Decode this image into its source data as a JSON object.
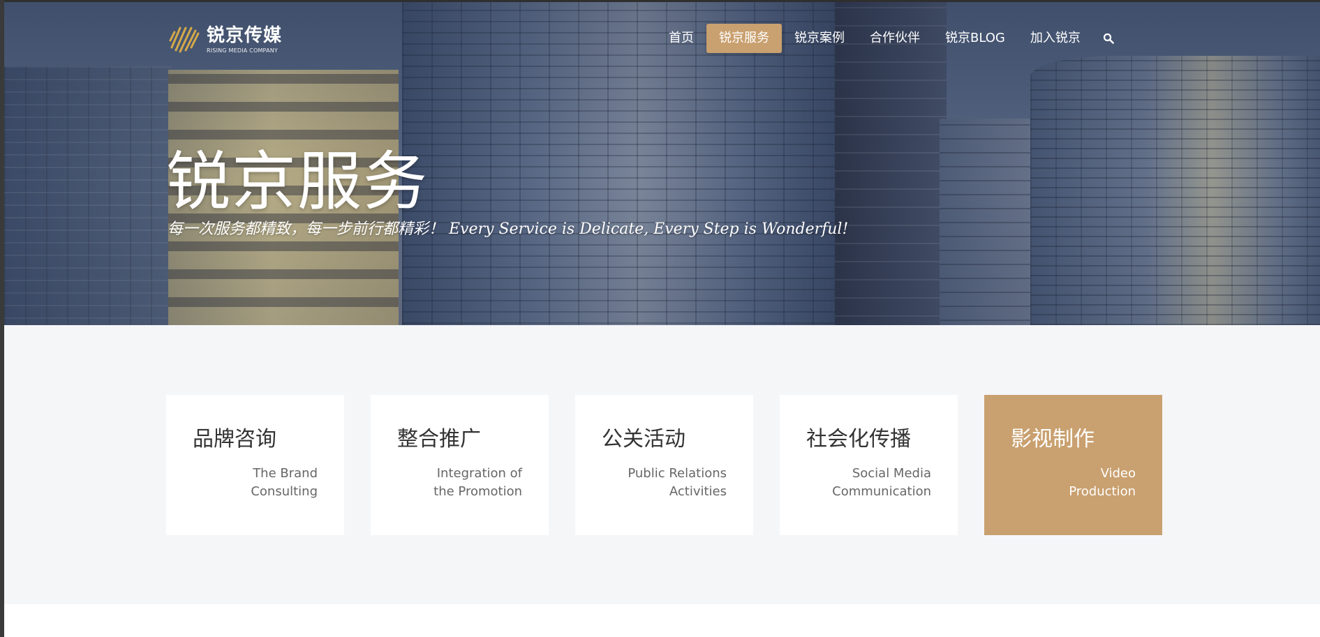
{
  "header": {
    "logo": {
      "name_cn": "锐京传媒",
      "name_en": "RISING MEDIA COMPANY",
      "accent_color": "#d4a94a"
    },
    "nav": [
      {
        "label": "首页",
        "active": false
      },
      {
        "label": "锐京服务",
        "active": true
      },
      {
        "label": "锐京案例",
        "active": false
      },
      {
        "label": "合作伙伴",
        "active": false
      },
      {
        "label": "锐京BLOG",
        "active": false
      },
      {
        "label": "加入锐京",
        "active": false
      }
    ],
    "search_icon": "search-icon"
  },
  "hero": {
    "title": "锐京服务",
    "subtitle": "每一次服务都精致，每一步前行都精彩！ Every Service is Delicate, Every Step is Wonderful!"
  },
  "services": {
    "cards": [
      {
        "title_cn": "品牌咨询",
        "title_en": "The Brand\nConsulting"
      },
      {
        "title_cn": "整合推广",
        "title_en": "Integration of\nthe Promotion"
      },
      {
        "title_cn": "公关活动",
        "title_en": "Public Relations\nActivities"
      },
      {
        "title_cn": "社会化传播",
        "title_en": "Social Media\nCommunication"
      },
      {
        "title_cn": "影视制作",
        "title_en": "Video\nProduction"
      }
    ],
    "highlight_color": "#c9a06f"
  }
}
